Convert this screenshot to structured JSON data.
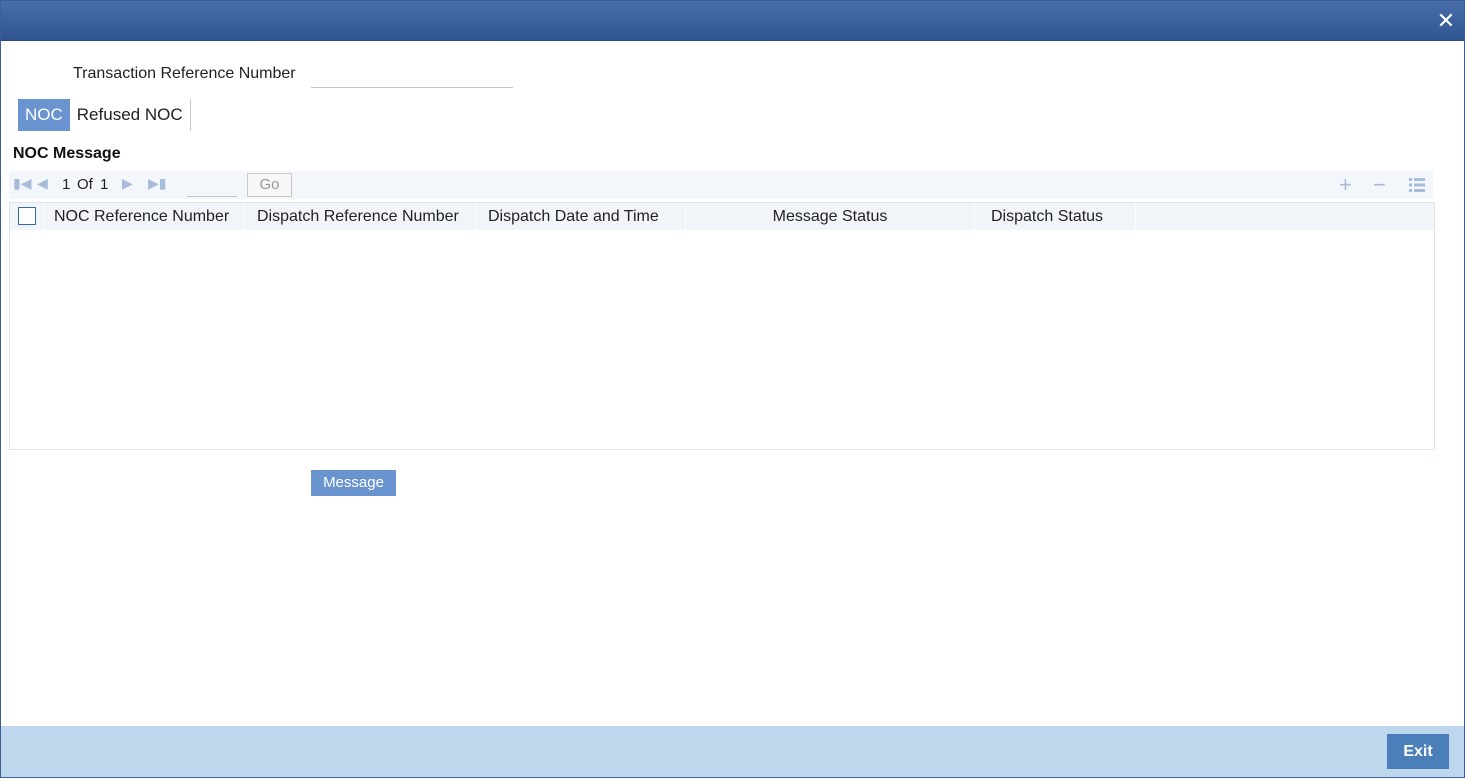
{
  "window": {
    "close_label": "✕"
  },
  "form": {
    "transaction_ref_label": "Transaction Reference Number",
    "transaction_ref_value": ""
  },
  "tabs": [
    {
      "label": "NOC",
      "active": true
    },
    {
      "label": "Refused NOC",
      "active": false
    }
  ],
  "section": {
    "title": "NOC Message"
  },
  "pager": {
    "current": "1",
    "of_label": "Of",
    "total": "1",
    "goto_value": "",
    "go_label": "Go"
  },
  "grid": {
    "columns": [
      "NOC Reference Number",
      "Dispatch Reference Number",
      "Dispatch Date and Time",
      "Message Status",
      "Dispatch Status"
    ],
    "rows": []
  },
  "buttons": {
    "message_label": "Message",
    "exit_label": "Exit"
  },
  "colors": {
    "titlebar": "#2f5591",
    "accent": "#6a94cf",
    "footer": "#bfd7ec",
    "exit": "#4b7fba"
  }
}
